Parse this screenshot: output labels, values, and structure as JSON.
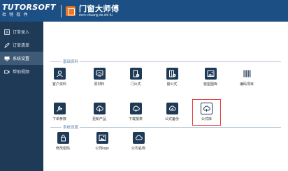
{
  "header": {
    "logo_main": "TUTORSOFT",
    "logo_sub": "杜特软件",
    "brand_title": "门窗大师傅",
    "brand_sub": "men chuang da shi fu"
  },
  "sidebar": {
    "items": [
      {
        "label": "订单录入",
        "icon": "order-entry-icon"
      },
      {
        "label": "订单清单",
        "icon": "order-list-icon"
      },
      {
        "label": "系统设置",
        "icon": "monitor-icon",
        "active": true
      },
      {
        "label": "帮助视频",
        "icon": "video-icon"
      }
    ]
  },
  "main": {
    "sections": [
      {
        "title": "基础资料",
        "tiles": [
          {
            "label": "客户资料",
            "icon": "customer-icon"
          },
          {
            "label": "原材料",
            "icon": "material-icon"
          },
          {
            "label": "门公式",
            "icon": "door-formula-icon"
          },
          {
            "label": "窗公式",
            "icon": "window-formula-icon"
          },
          {
            "label": "窗型图库",
            "icon": "image-library-icon"
          },
          {
            "label": "编码项目",
            "icon": "barcode-icon"
          },
          {
            "label": "下单参数",
            "icon": "parameter-icon"
          },
          {
            "label": "更新产品",
            "icon": "cloud-update-icon"
          },
          {
            "label": "下载报表",
            "icon": "cloud-download-icon"
          },
          {
            "label": "公式备份",
            "icon": "cloud-backup-icon"
          },
          {
            "label": "公式库",
            "icon": "cloud-library-icon",
            "selected": true
          }
        ]
      },
      {
        "title": "系统设置",
        "tiles": [
          {
            "label": "修改密码",
            "icon": "lock-icon"
          },
          {
            "label": "公司logo",
            "icon": "image-icon"
          },
          {
            "label": "公司名称",
            "icon": "cloud-icon"
          }
        ]
      }
    ]
  },
  "colors": {
    "header_bg": "#1c4f83",
    "sidebar_bg": "#1f3a56",
    "sidebar_active": "#3f5a76",
    "tile_icon_bg": "#1f3a56",
    "selection_border": "#e33b3b",
    "section_title": "#5f85ad"
  }
}
